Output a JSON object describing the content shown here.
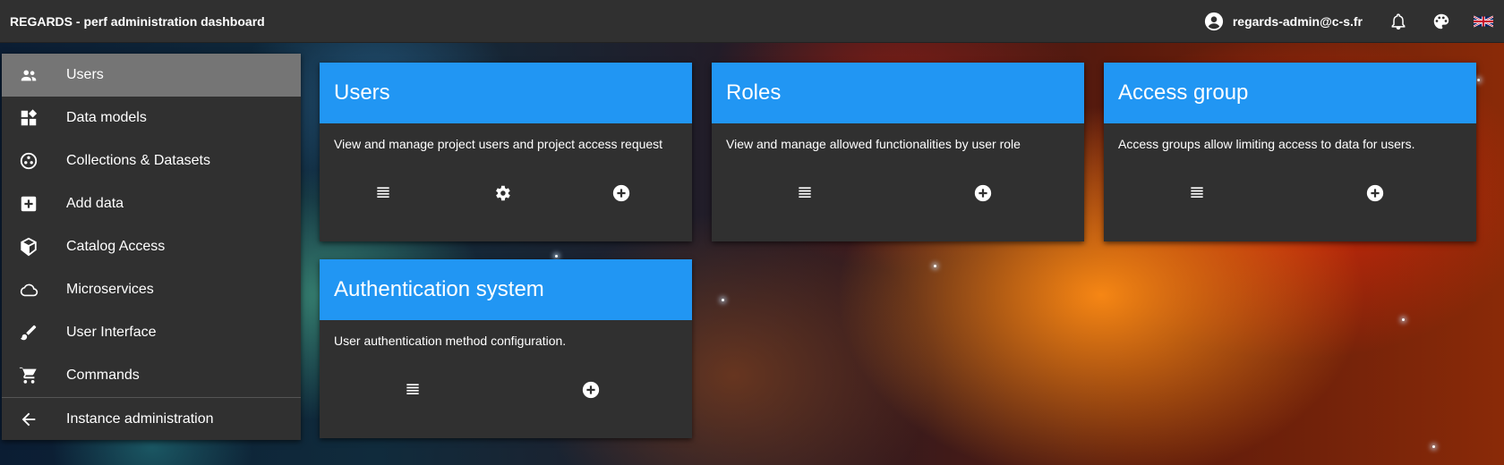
{
  "header": {
    "title": "REGARDS - perf administration dashboard",
    "user_email": "regards-admin@c-s.fr",
    "icons": [
      "account-circle-icon",
      "notifications-bell-icon",
      "palette-icon",
      "uk-flag-icon"
    ]
  },
  "sidebar": {
    "items": [
      {
        "label": "Users",
        "icon": "people-icon",
        "active": true
      },
      {
        "label": "Data models",
        "icon": "widgets-icon"
      },
      {
        "label": "Collections & Datasets",
        "icon": "bubbles-icon"
      },
      {
        "label": "Add data",
        "icon": "add-box-icon"
      },
      {
        "label": "Catalog Access",
        "icon": "cube-icon"
      },
      {
        "label": "Microservices",
        "icon": "cloud-icon"
      },
      {
        "label": "User Interface",
        "icon": "brush-icon"
      },
      {
        "label": "Commands",
        "icon": "cart-icon"
      },
      {
        "label": "Instance administration",
        "icon": "arrow-back-icon"
      }
    ]
  },
  "cards": [
    {
      "title": "Users",
      "description": "View and manage project users and project access request",
      "actions": [
        "list-icon",
        "settings-gear-icon",
        "add-circle-icon"
      ]
    },
    {
      "title": "Roles",
      "description": "View and manage allowed functionalities by user role",
      "actions": [
        "list-icon",
        "add-circle-icon"
      ]
    },
    {
      "title": "Access group",
      "description": "Access groups allow limiting access to data for users.",
      "actions": [
        "list-icon",
        "add-circle-icon"
      ]
    },
    {
      "title": "Authentication system",
      "description": "User authentication method configuration.",
      "actions": [
        "list-icon",
        "add-circle-icon"
      ]
    }
  ],
  "colors": {
    "topbar": "#303030",
    "panel": "#303030",
    "active_item": "#757575",
    "card_header": "#2196f3"
  }
}
